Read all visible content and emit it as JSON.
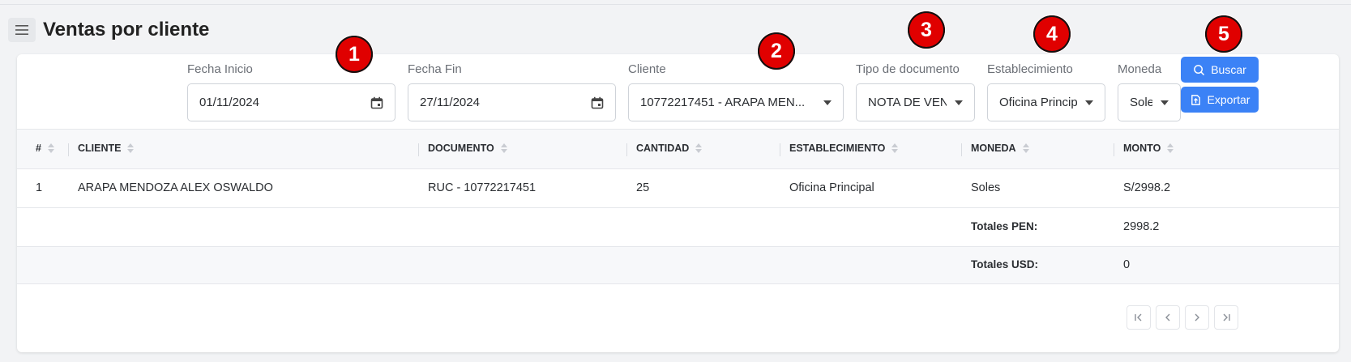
{
  "page": {
    "title": "Ventas por cliente"
  },
  "filters": {
    "fecha_inicio": {
      "label": "Fecha Inicio",
      "value": "01/11/2024"
    },
    "fecha_fin": {
      "label": "Fecha Fin",
      "value": "27/11/2024"
    },
    "cliente": {
      "label": "Cliente",
      "value": "10772217451 - ARAPA MEN..."
    },
    "tipo_documento": {
      "label": "Tipo de documento",
      "value": "NOTA DE VENTA"
    },
    "establecimiento": {
      "label": "Establecimiento",
      "value": "Oficina Principal"
    },
    "moneda": {
      "label": "Moneda",
      "value": "Soles"
    }
  },
  "actions": {
    "buscar": "Buscar",
    "exportar": "Exportar"
  },
  "table": {
    "columns": [
      "#",
      "CLIENTE",
      "DOCUMENTO",
      "CANTIDAD",
      "ESTABLECIMIENTO",
      "MONEDA",
      "MONTO"
    ],
    "rows": [
      [
        "1",
        "ARAPA MENDOZA ALEX OSWALDO",
        "RUC - 10772217451",
        "25",
        "Oficina Principal",
        "Soles",
        "S/2998.2"
      ]
    ],
    "totals": [
      {
        "label": "Totales PEN:",
        "value": "2998.2"
      },
      {
        "label": "Totales USD:",
        "value": "0"
      }
    ]
  },
  "annotations": [
    "1",
    "2",
    "3",
    "4",
    "5"
  ],
  "icons": {
    "menu": "menu-icon",
    "calendar": "calendar-icon",
    "search": "search-icon",
    "export": "export-icon",
    "first": "first-page-icon",
    "prev": "prev-page-icon",
    "next": "next-page-icon",
    "last": "last-page-icon"
  },
  "colors": {
    "primary": "#3b82f6",
    "badge": "#e00000",
    "background": "#f2f3f5"
  }
}
